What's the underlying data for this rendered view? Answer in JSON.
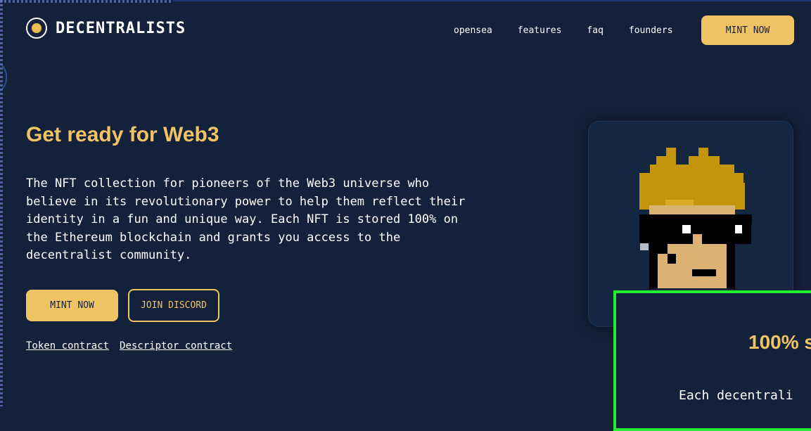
{
  "brand": {
    "name": "DECENTRALISTS",
    "icon": "logo-circle-icon",
    "accent": "#f0c365",
    "background": "#13223a"
  },
  "nav": {
    "links": [
      "opensea",
      "features",
      "faq",
      "founders"
    ],
    "mint_label": "MINT NOW"
  },
  "hero": {
    "title": "Get ready for Web3",
    "description_lines": [
      "The NFT collection for pioneers of the Web3 universe who",
      "believe in its revolutionary power to help them reflect their",
      "identity in a fun and unique way. Each NFT is stored 100% on",
      "the Ethereum blockchain and grants you access to the",
      "decentralist community."
    ],
    "mint_label": "MINT NOW",
    "discord_label": "JOIN DISCORD",
    "links": [
      "Token contract",
      "Descriptor contract"
    ]
  },
  "nft_card": {
    "image": "pixel-avatar-icon"
  },
  "overlay": {
    "title": "100% s",
    "text": "Each decentrali",
    "border_color": "#22ee33"
  }
}
